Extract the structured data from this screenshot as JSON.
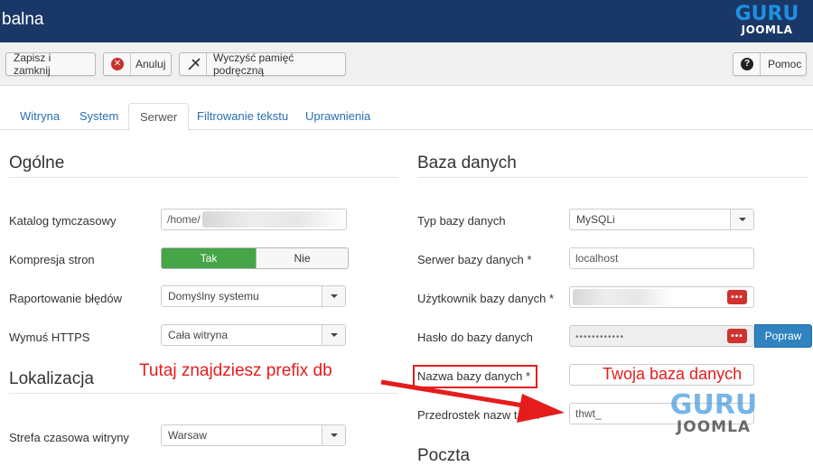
{
  "header": {
    "title": "balna",
    "logo_top": "GURU",
    "logo_bottom": "JOOMLA"
  },
  "toolbar": {
    "save_close": "Zapisz i zamknij",
    "cancel": "Anuluj",
    "clear_cache": "Wyczyść pamięć podręczną",
    "help": "Pomoc",
    "cancel_icon": "x-circle-icon",
    "clear_icon": "broom-icon",
    "help_icon": "question-circle-icon"
  },
  "tabs": [
    {
      "label": "Witryna"
    },
    {
      "label": "System"
    },
    {
      "label": "Serwer",
      "active": true
    },
    {
      "label": "Filtrowanie tekstu"
    },
    {
      "label": "Uprawnienia"
    }
  ],
  "general": {
    "title": "Ogólne",
    "temp_dir_label": "Katalog tymczasowy",
    "temp_dir_value": "/home/",
    "gzip_label": "Kompresja stron",
    "gzip_yes": "Tak",
    "gzip_no": "Nie",
    "error_label": "Raportowanie błędów",
    "error_value": "Domyślny systemu",
    "https_label": "Wymuś HTTPS",
    "https_value": "Cała witryna"
  },
  "locale": {
    "title": "Lokalizacja",
    "tz_label": "Strefa czasowa witryny",
    "tz_value": "Warsaw"
  },
  "database": {
    "title": "Baza danych",
    "type_label": "Typ bazy danych",
    "type_value": "MySQLi",
    "host_label": "Serwer bazy danych *",
    "host_value": "localhost",
    "user_label": "Użytkownik bazy danych *",
    "password_label": "Hasło do bazy danych",
    "password_value": "••••••••••••",
    "password_button": "Popraw",
    "name_label": "Nazwa bazy danych *",
    "prefix_label": "Przedrostek nazw tabel",
    "prefix_value": "thwt_",
    "toggle_icon_text": "•••"
  },
  "mail": {
    "title": "Poczta"
  },
  "annotations": {
    "prefix_note": "Tutaj znajdziesz prefix db",
    "db_note": "Twoja baza danych",
    "watermark_top": "GURU",
    "watermark_bottom": "JOOMLA"
  },
  "colors": {
    "header_bg": "#1a3867",
    "accent_link": "#2a6fb0",
    "toggle_on": "#46a546",
    "danger": "#d0322f",
    "primary_button": "#2f83c0",
    "annotation_red": "#e51c1c"
  }
}
